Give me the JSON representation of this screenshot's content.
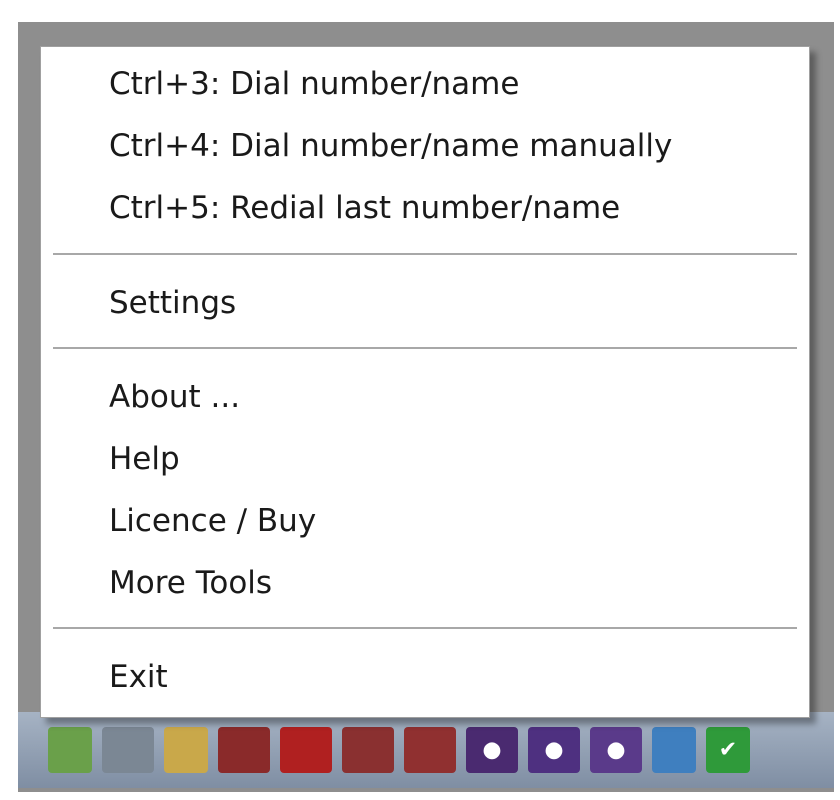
{
  "menu": {
    "items": [
      {
        "label": "Ctrl+3: Dial number/name"
      },
      {
        "label": "Ctrl+4: Dial number/name manually"
      },
      {
        "label": "Ctrl+5: Redial last number/name"
      },
      {
        "label": "Settings"
      },
      {
        "label": "About ..."
      },
      {
        "label": "Help"
      },
      {
        "label": "Licence / Buy"
      },
      {
        "label": "More Tools"
      },
      {
        "label": "Exit"
      }
    ]
  },
  "tray": {
    "icons": [
      {
        "name": "network-icon",
        "color": "#6aa04a"
      },
      {
        "name": "monitor-icon",
        "color": "#7b8794"
      },
      {
        "name": "folder-icon",
        "color": "#c9a84a"
      },
      {
        "name": "app-red-icon",
        "color": "#8a2a2a"
      },
      {
        "name": "app-red-icon-2",
        "color": "#b02020"
      },
      {
        "name": "app-red-icon-3",
        "color": "#8a3030"
      },
      {
        "name": "app-red-icon-4",
        "color": "#903030"
      },
      {
        "name": "app-purple-icon",
        "color": "#4a2a70"
      },
      {
        "name": "app-purple-icon-2",
        "color": "#4e3080"
      },
      {
        "name": "app-purple-icon-3",
        "color": "#5a3a8a"
      },
      {
        "name": "app-blue-icon",
        "color": "#3f7fbf"
      },
      {
        "name": "checkmark-icon",
        "color": "#2f9a3a"
      }
    ]
  }
}
